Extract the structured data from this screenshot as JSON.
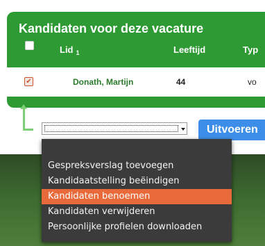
{
  "panel": {
    "title": "Kandidaten voor deze vacature",
    "columns": {
      "lid": "Lid",
      "lid_sort": "1",
      "age": "Leeftijd",
      "type": "Typ"
    }
  },
  "rows": [
    {
      "name": "Donath, Martijn",
      "age": "44",
      "type": "vo",
      "checked": true
    }
  ],
  "actions": {
    "select_value": "",
    "button_label": "Uitvoeren",
    "menu_items": [
      "Gespreksverslag toevoegen",
      "Kandidaatstelling beëindigen",
      "Kandidaten benoemen",
      "Kandidaten verwijderen",
      "Persoonlijke profielen downloaden"
    ],
    "selected_index": 2
  },
  "colors": {
    "panel_green": "#2d9a34",
    "name_green": "#2c7a2c",
    "button_blue": "#3d8ee8",
    "menu_highlight": "#e8693a",
    "menu_bg": "#3b3b3b"
  },
  "icons": [
    "checkbox-icon",
    "connector-arrow-icon",
    "chevron-down-icon"
  ]
}
